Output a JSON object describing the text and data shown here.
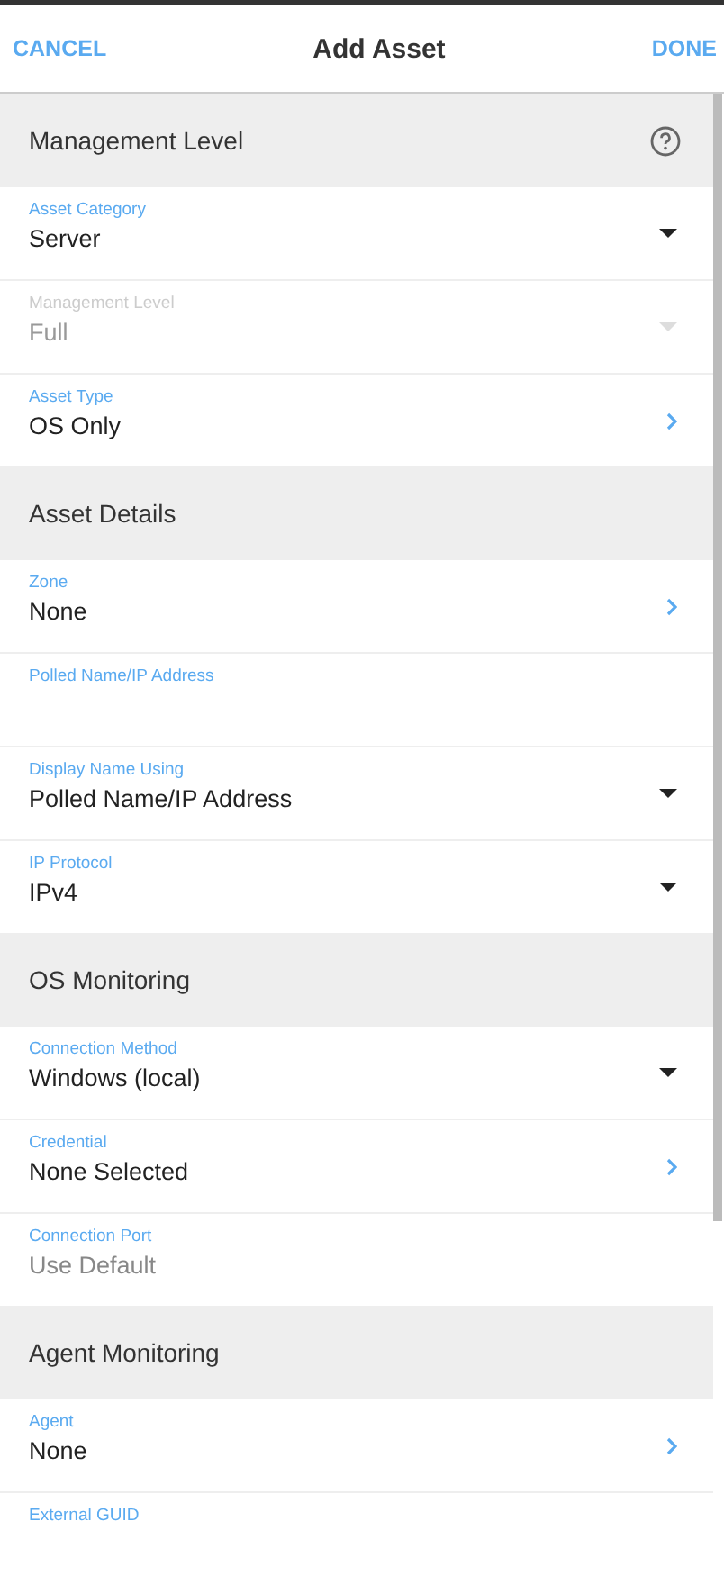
{
  "header": {
    "cancel": "CANCEL",
    "title": "Add Asset",
    "done": "DONE"
  },
  "sections": [
    {
      "title": "Management Level",
      "help": true,
      "rows": [
        {
          "label": "Asset Category",
          "value": "Server",
          "kind": "dropdown",
          "disabled": false
        },
        {
          "label": "Management Level",
          "value": "Full",
          "kind": "dropdown",
          "disabled": true
        },
        {
          "label": "Asset Type",
          "value": "OS Only",
          "kind": "link",
          "disabled": false
        }
      ]
    },
    {
      "title": "Asset Details",
      "help": false,
      "rows": [
        {
          "label": "Zone",
          "value": "None",
          "kind": "link",
          "disabled": false
        },
        {
          "label": "Polled Name/IP Address",
          "kind": "text",
          "disabled": false
        },
        {
          "label": "Display Name Using",
          "value": "Polled Name/IP Address",
          "kind": "dropdown",
          "disabled": false
        },
        {
          "label": "IP Protocol",
          "value": "IPv4",
          "kind": "dropdown",
          "disabled": false
        }
      ]
    },
    {
      "title": "OS Monitoring",
      "help": false,
      "rows": [
        {
          "label": "Connection Method",
          "value": "Windows (local)",
          "kind": "dropdown",
          "disabled": false
        },
        {
          "label": "Credential",
          "value": "None Selected",
          "kind": "link",
          "disabled": false
        },
        {
          "label": "Connection Port",
          "placeholder": "Use Default",
          "kind": "text",
          "disabled": false
        }
      ]
    },
    {
      "title": "Agent Monitoring",
      "help": false,
      "rows": [
        {
          "label": "Agent",
          "value": "None",
          "kind": "link",
          "disabled": false
        },
        {
          "label": "External GUID",
          "kind": "text",
          "disabled": false
        }
      ]
    }
  ]
}
